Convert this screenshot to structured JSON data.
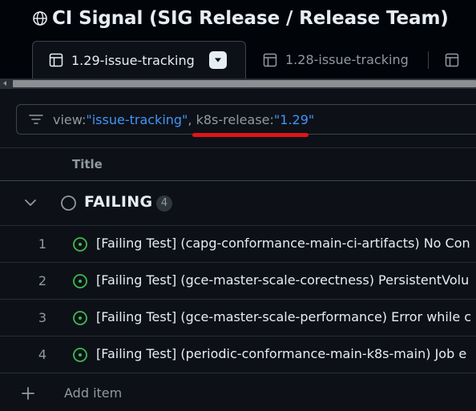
{
  "project": {
    "title": "CI Signal (SIG Release / Release Team)",
    "icon": "globe-icon"
  },
  "tabs": [
    {
      "label": "1.29-issue-tracking",
      "icon": "table-icon",
      "active": true
    },
    {
      "label": "1.28-issue-tracking",
      "icon": "table-icon",
      "active": false
    },
    {
      "label": "",
      "icon": "table-icon",
      "active": false
    }
  ],
  "filter": {
    "icon": "filter-icon",
    "view_key": "view:",
    "view_value": "\"issue-tracking\"",
    "separator": ",",
    "release_key": "k8s-release:",
    "release_value": "\"1.29\"",
    "highlight_color": "#e0131b"
  },
  "table": {
    "column_title": "Title",
    "group": {
      "name": "FAILING",
      "count": "4",
      "icon": "circle-icon"
    },
    "rows": [
      {
        "num": "1",
        "title": "[Failing Test] (capg-conformance-main-ci-artifacts) No Con"
      },
      {
        "num": "2",
        "title": "[Failing Test] (gce-master-scale-corectness) PersistentVolu"
      },
      {
        "num": "3",
        "title": "[Failing Test] (gce-master-scale-performance) Error while c"
      },
      {
        "num": "4",
        "title": "[Failing Test] (periodic-conformance-main-k8s-main) Job e"
      }
    ],
    "row_icon": "open-issue-icon",
    "row_icon_color": "#3fb950",
    "add_item_label": "Add item"
  }
}
